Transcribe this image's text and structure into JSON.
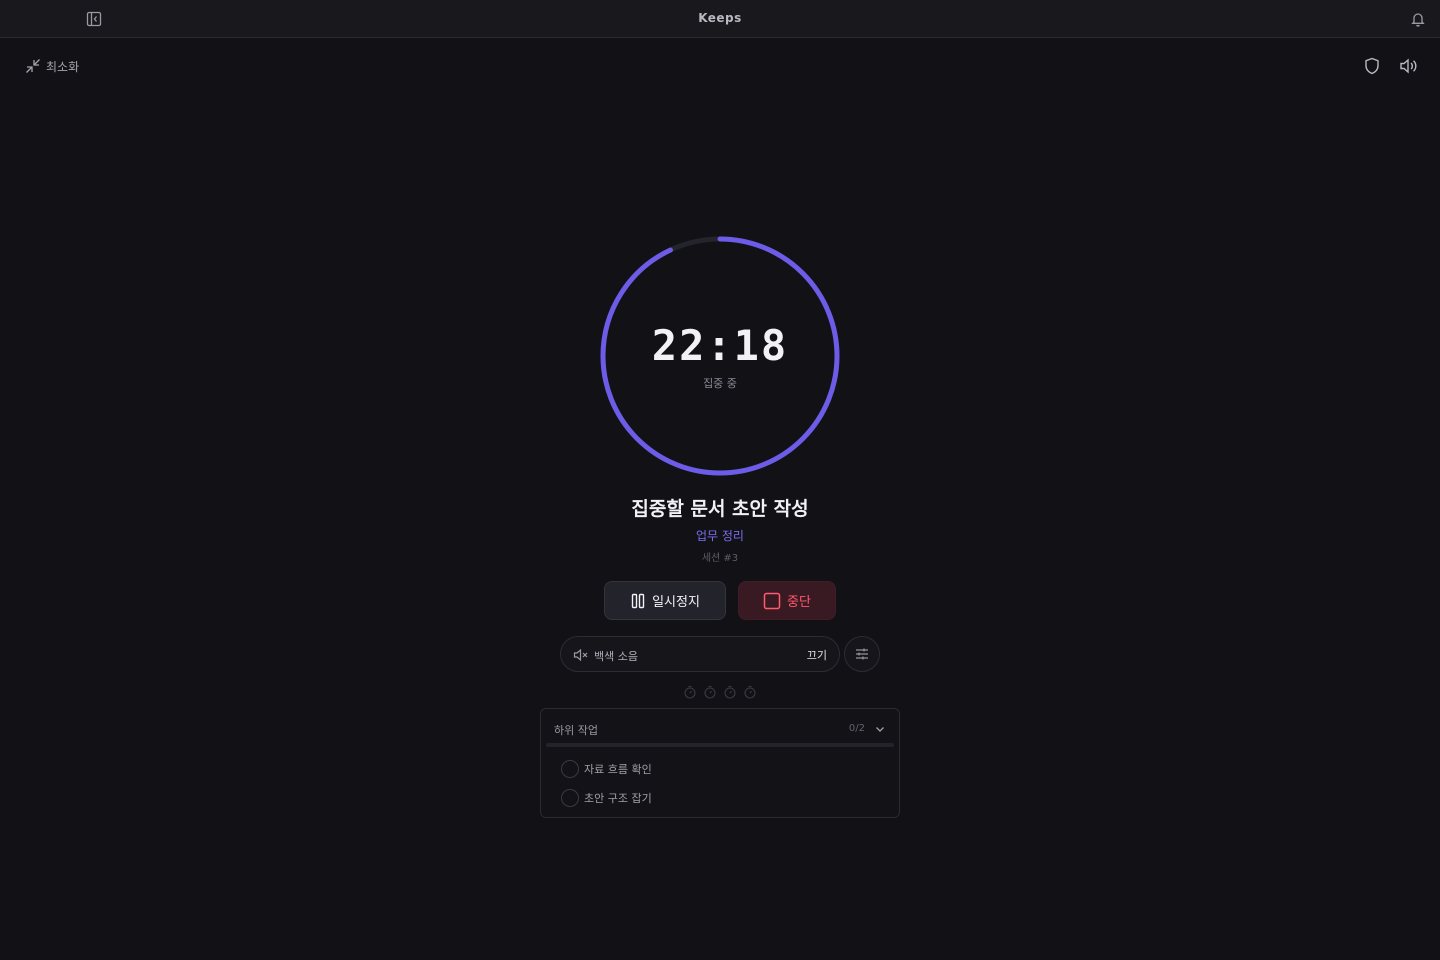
{
  "app": {
    "title": "Keeps"
  },
  "header": {
    "minimize_label": "최소화"
  },
  "timer": {
    "time": "22:18",
    "status": "집중 중",
    "progress": 0.93,
    "colors": {
      "accent": "#6c5ce7",
      "track": "#24242c"
    }
  },
  "task": {
    "title": "집중할 문서 초안 작성",
    "category": "업무 정리",
    "session": "세션 #3"
  },
  "controls": {
    "pause_label": "일시정지",
    "stop_label": "중단"
  },
  "ambient": {
    "label": "백색 소음",
    "toggle_label": "끄기"
  },
  "session_dots": [
    {
      "icon": "timer-icon",
      "state": "pending"
    },
    {
      "icon": "timer-icon",
      "state": "pending"
    },
    {
      "icon": "timer-icon",
      "state": "pending"
    },
    {
      "icon": "timer-icon",
      "state": "pending"
    }
  ],
  "subtasks": {
    "title": "하위 작업",
    "count": "0/2",
    "progress": 0,
    "items": [
      {
        "label": "자료 흐름 확인",
        "done": false
      },
      {
        "label": "초안 구조 잡기",
        "done": false
      }
    ]
  }
}
